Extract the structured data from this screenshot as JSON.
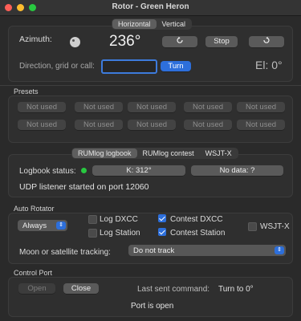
{
  "window": {
    "title": "Rotor - Green Heron"
  },
  "mode_tabs": [
    {
      "label": "Horizontal",
      "selected": true
    },
    {
      "label": "Vertical",
      "selected": false
    }
  ],
  "rotor": {
    "azimuth_label": "Azimuth:",
    "azimuth_value": "236°",
    "ccw_icon": "rotate-left-icon",
    "stop_label": "Stop",
    "cw_icon": "rotate-right-icon",
    "direction_label": "Direction, grid or call:",
    "direction_value": "",
    "turn_label": "Turn",
    "elevation": "El: 0°"
  },
  "presets": {
    "title": "Presets",
    "buttons": [
      "Not used",
      "Not used",
      "Not used",
      "Not used",
      "Not used",
      "Not used",
      "Not used",
      "Not used",
      "Not used",
      "Not used"
    ]
  },
  "log_tabs": [
    {
      "label": "RUMlog logbook",
      "selected": true
    },
    {
      "label": "RUMlog contest",
      "selected": false
    },
    {
      "label": "WSJT-X",
      "selected": false
    }
  ],
  "logbook": {
    "status_label": "Logbook status:",
    "status_color": "#28c840",
    "k_value": "K: 312°",
    "no_data": "No data: ?",
    "udp_message": "UDP listener started on port 12060"
  },
  "auto_rotator": {
    "title": "Auto Rotator",
    "mode_value": "Always",
    "log_dxcc": {
      "label": "Log DXCC",
      "checked": false
    },
    "log_station": {
      "label": "Log Station",
      "checked": false
    },
    "contest_dxcc": {
      "label": "Contest DXCC",
      "checked": true
    },
    "contest_station": {
      "label": "Contest Station",
      "checked": true
    },
    "wsjtx": {
      "label": "WSJT-X",
      "checked": false
    },
    "tracking_label": "Moon or satellite tracking:",
    "tracking_value": "Do not track"
  },
  "control_port": {
    "title": "Control Port",
    "open_label": "Open",
    "close_label": "Close",
    "last_sent_label": "Last sent command:",
    "last_sent_value": "Turn to 0°",
    "status": "Port is open"
  },
  "colors": {
    "accent": "#2d6fdb",
    "close": "#ff5f57",
    "minimize": "#febc2e",
    "zoom": "#28c840"
  }
}
